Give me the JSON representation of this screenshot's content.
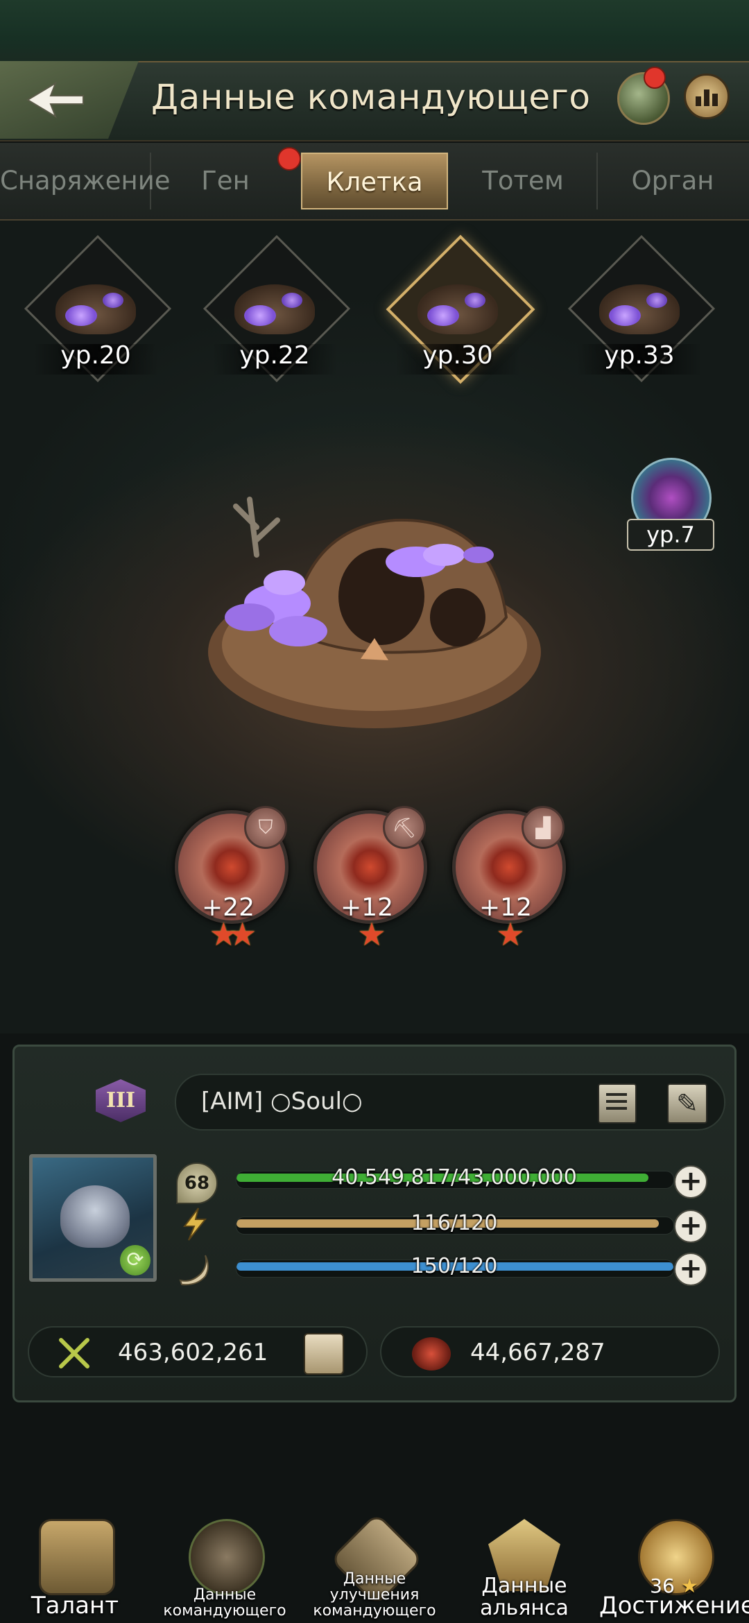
{
  "header": {
    "title": "Данные командующего"
  },
  "tabs": [
    {
      "label": "Снаряжение"
    },
    {
      "label": "Ген"
    },
    {
      "label": "Клетка"
    },
    {
      "label": "Тотем"
    },
    {
      "label": "Орган"
    }
  ],
  "active_tab": "Клетка",
  "cells": [
    {
      "level": "ур.20"
    },
    {
      "level": "ур.22"
    },
    {
      "level": "ур.30"
    },
    {
      "level": "ур.33"
    }
  ],
  "orb": {
    "level": "ур.7"
  },
  "bonuses": [
    {
      "value": "+22",
      "stars": 2,
      "icon": "shield-icon"
    },
    {
      "value": "+12",
      "stars": 1,
      "icon": "pickaxe-icon"
    },
    {
      "value": "+12",
      "stars": 1,
      "icon": "boot-icon"
    }
  ],
  "commander": {
    "rank": "III",
    "name": "[AIM]  ○Soul○",
    "level": "68",
    "exp": {
      "text": "40,549,817/43,000,000",
      "fill": 0.943
    },
    "energy": {
      "text": "116/120",
      "fill": 0.967
    },
    "horn": {
      "text": "150/120",
      "fill": 1.0
    },
    "power": "463,602,261",
    "kills": "44,667,287"
  },
  "colors": {
    "exp_bar": "#3fae35",
    "energy_bar": "#c4a062",
    "horn_bar": "#3d8fd0",
    "accent_gold": "#d4b06a",
    "notification": "#e0362c"
  },
  "nav": {
    "talent": "Талант",
    "commander_data": "Данные командующего",
    "upgrade_data": "Данные улучшения командующего",
    "alliance_data": "Данные альянса",
    "achievement": "Достижение",
    "achievement_count": "36"
  }
}
